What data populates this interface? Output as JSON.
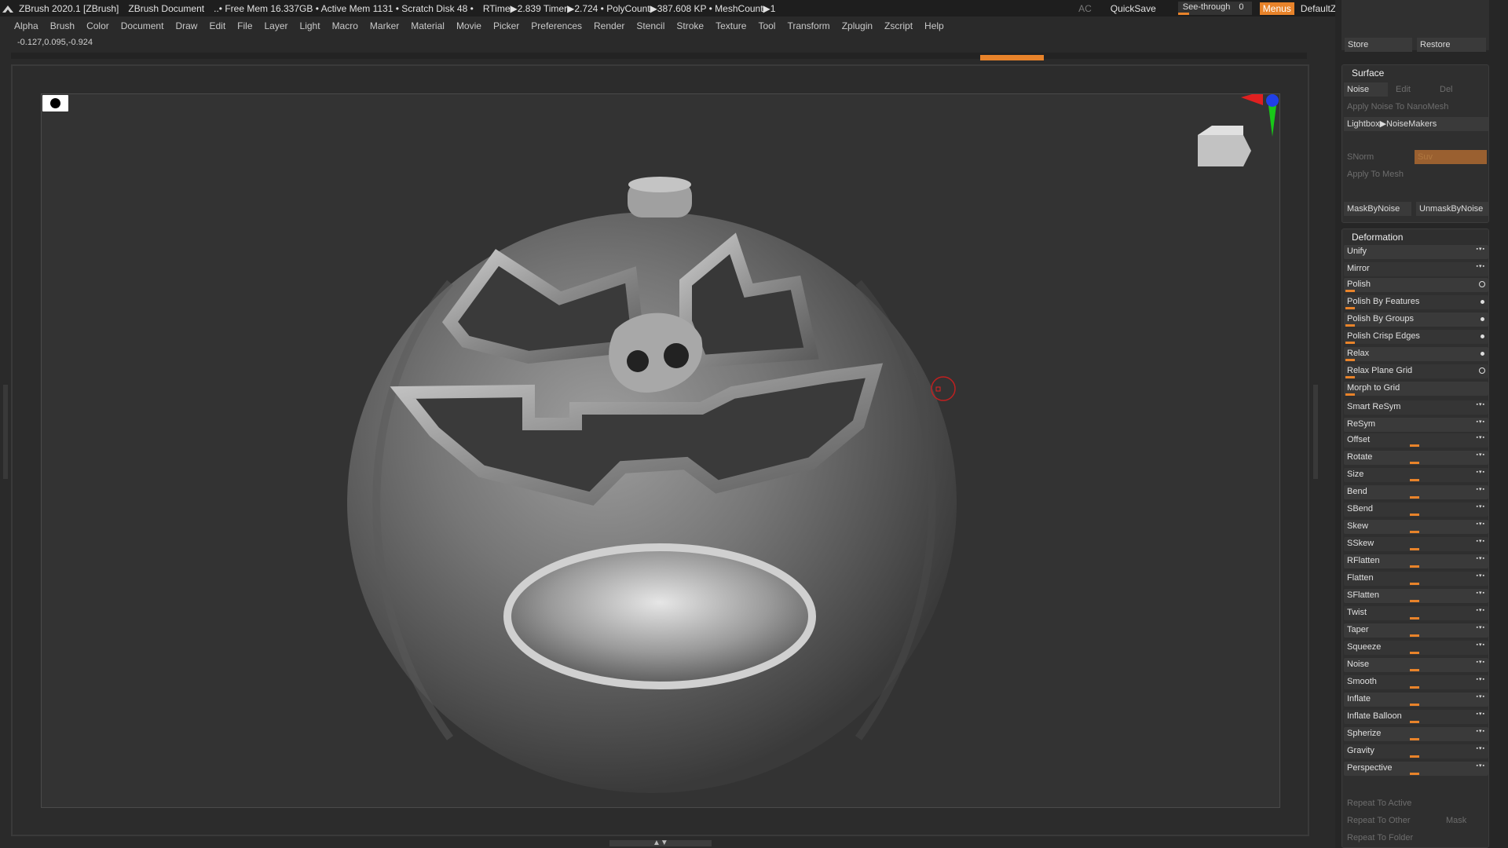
{
  "titlebar": {
    "app": "ZBrush 2020.1 [ZBrush]",
    "document": "ZBrush Document",
    "stats": "..• Free Mem 16.337GB • Active Mem 1131 • Scratch Disk 48 •",
    "timing": "RTime▶2.839 Timer▶2.724 • PolyCount▶387.608 KP • MeshCount▶1",
    "ac": "AC",
    "quicksave": "QuickSave",
    "see_through_label": "See-through",
    "see_through_value": "0",
    "menus": "Menus",
    "default_zscript": "DefaultZScript"
  },
  "menubar": [
    "Alpha",
    "Brush",
    "Color",
    "Document",
    "Draw",
    "Edit",
    "File",
    "Layer",
    "Light",
    "Macro",
    "Marker",
    "Material",
    "Movie",
    "Picker",
    "Preferences",
    "Render",
    "Stencil",
    "Stroke",
    "Texture",
    "Tool",
    "Transform",
    "Zplugin",
    "Zscript",
    "Help"
  ],
  "coords": "-0.127,0.095,-0.924",
  "panel": {
    "store": "Store",
    "restore": "Restore",
    "surface": {
      "header": "Surface",
      "noise": "Noise",
      "edit": "Edit",
      "del": "Del",
      "apply_noise_nano": "Apply Noise To NanoMesh",
      "lightbox_noise": "Lightbox▶NoiseMakers",
      "snorm": "SNorm",
      "suv": "Suv",
      "apply_to_mesh": "Apply To Mesh",
      "mask_by_noise": "MaskByNoise",
      "unmask_by_noise": "UnmaskByNoise"
    },
    "deformation": {
      "header": "Deformation",
      "items": [
        "Unify",
        "Mirror",
        "Polish",
        "Polish By Features",
        "Polish By Groups",
        "Polish Crisp Edges",
        "Relax",
        "Relax Plane Grid",
        "Morph to Grid",
        "Smart ReSym",
        "ReSym",
        "Offset",
        "Rotate",
        "Size",
        "Bend",
        "SBend",
        "Skew",
        "SSkew",
        "RFlatten",
        "Flatten",
        "SFlatten",
        "Twist",
        "Taper",
        "Squeeze",
        "Noise",
        "Smooth",
        "Inflate",
        "Inflate Balloon",
        "Spherize",
        "Gravity",
        "Perspective"
      ],
      "repeat_active": "Repeat To Active",
      "repeat_other": "Repeat To Other",
      "mask": "Mask",
      "repeat_folder": "Repeat To Folder"
    }
  },
  "colors": {
    "accent": "#e8832a",
    "background": "#333333",
    "gizmo_x": "#e02020",
    "gizmo_y": "#18c818",
    "gizmo_z": "#2040e8"
  }
}
